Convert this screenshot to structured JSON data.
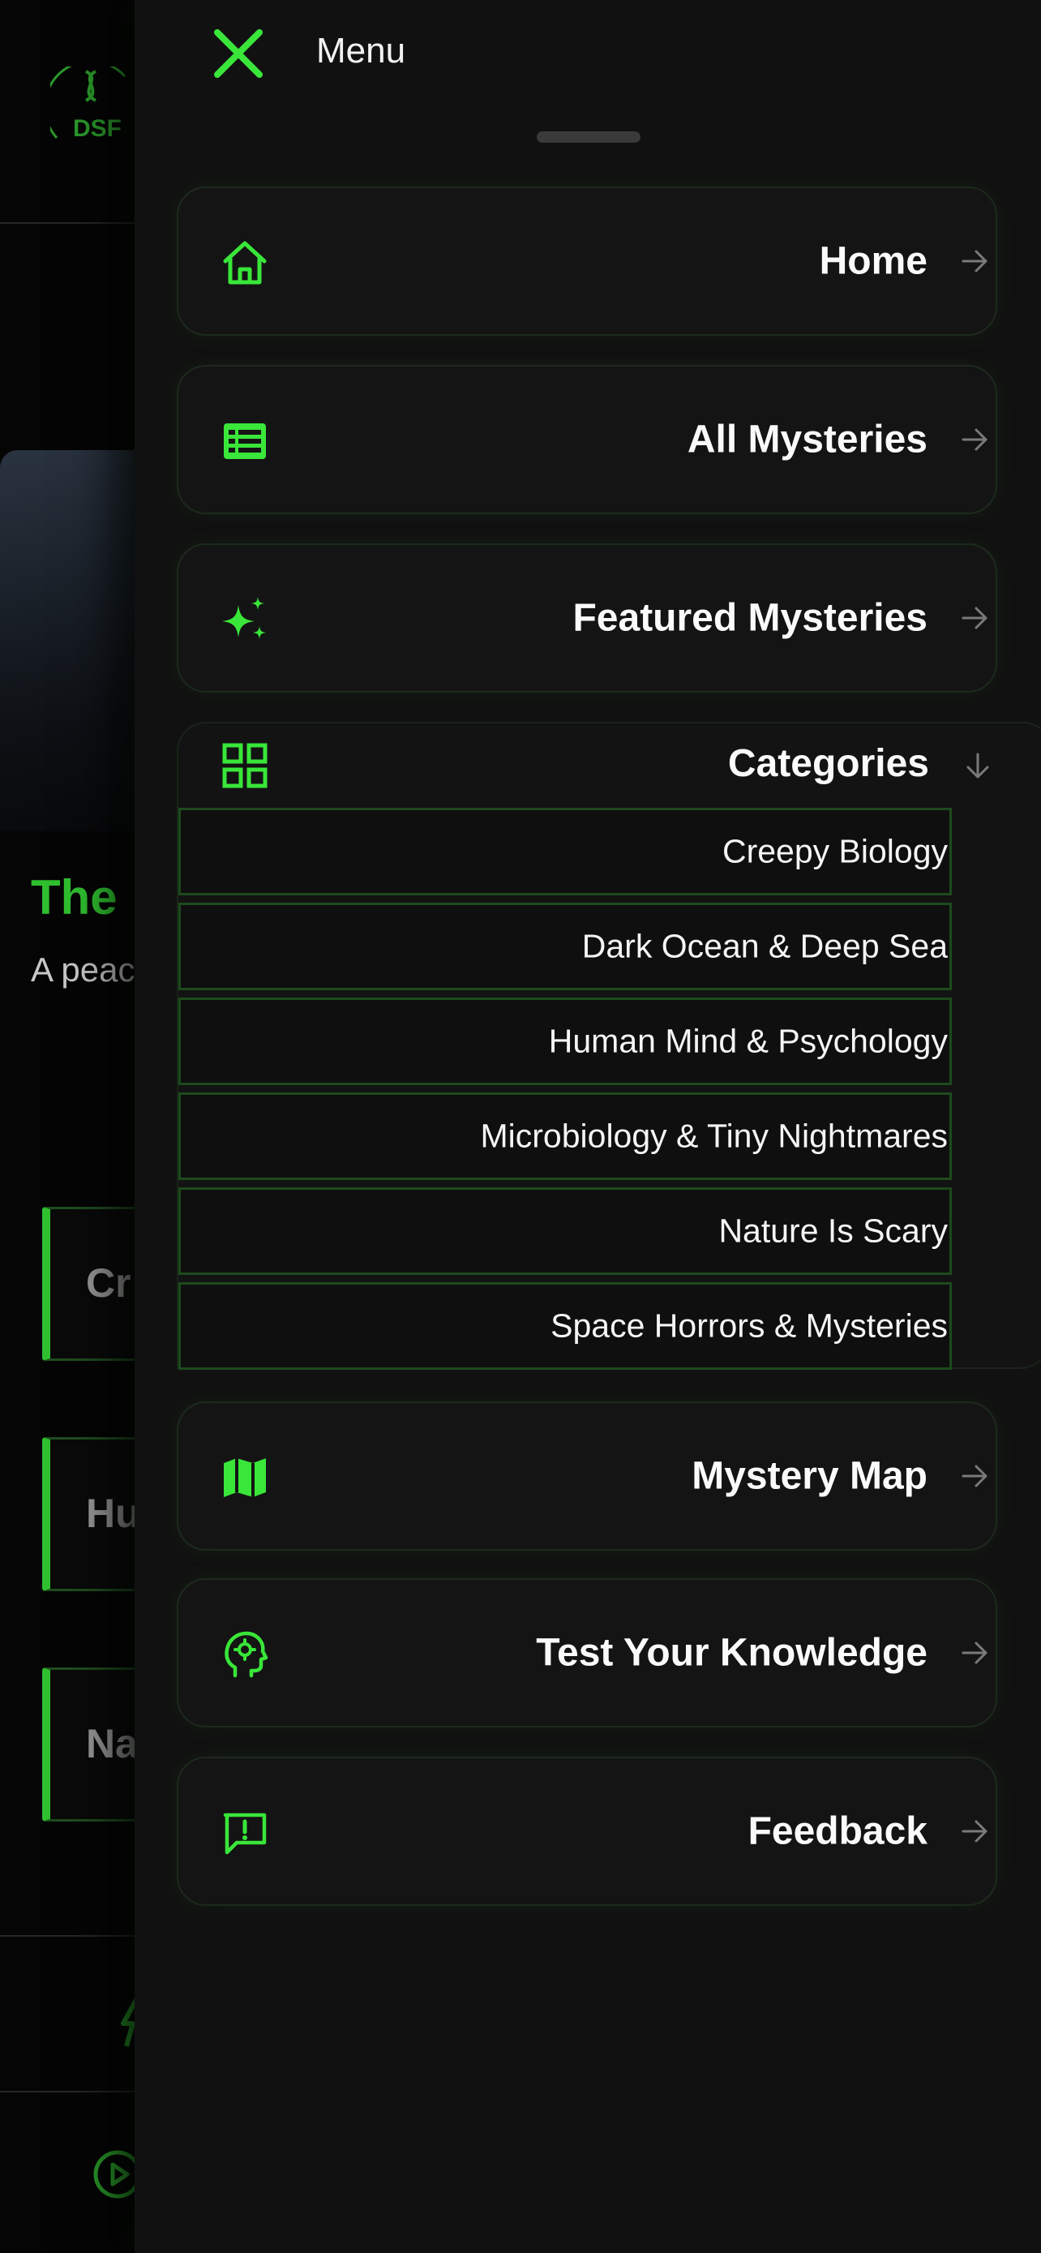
{
  "background": {
    "logo_text": "DSF",
    "hero_title": "The",
    "hero_subtitle": "A peac",
    "cards": [
      "Cr",
      "Hu",
      "Na"
    ]
  },
  "drawer": {
    "title": "Menu",
    "close_icon": "x-icon",
    "nav": [
      {
        "label": "Home",
        "icon": "home-icon"
      },
      {
        "label": "All Mysteries",
        "icon": "list-icon"
      },
      {
        "label": "Featured Mysteries",
        "icon": "sparkles-icon"
      },
      {
        "label": "Mystery Map",
        "icon": "map-icon"
      },
      {
        "label": "Test Your Knowledge",
        "icon": "brain-head-icon"
      },
      {
        "label": "Feedback",
        "icon": "feedback-icon"
      }
    ],
    "categories": {
      "label": "Categories",
      "icon": "grid-icon",
      "items": [
        "Creepy Biology",
        "Dark Ocean & Deep Sea",
        "Human Mind & Psychology",
        "Microbiology & Tiny Nightmares",
        "Nature Is Scary",
        "Space Horrors & Mysteries"
      ]
    }
  },
  "colors": {
    "accent": "#39e639",
    "drawer_bg": "#111111",
    "card_border": "#1c2a1c",
    "category_border": "#1d4a1d"
  }
}
